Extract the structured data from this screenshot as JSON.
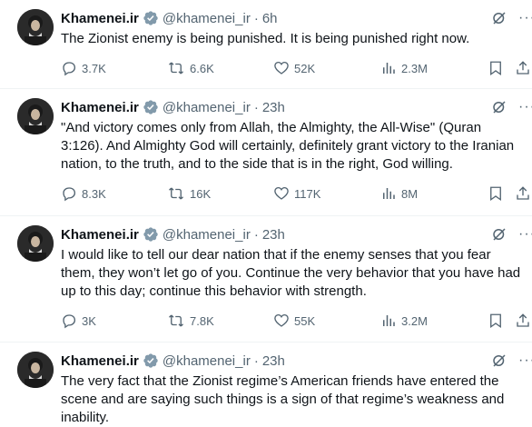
{
  "account": {
    "name": "Khamenei.ir",
    "handle": "@khamenei_ir",
    "dot": "·"
  },
  "more_label": "···",
  "tweets": [
    {
      "time": "6h",
      "text": "The Zionist enemy is being punished. It is being punished right now.",
      "replies": "3.7K",
      "reposts": "6.6K",
      "likes": "52K",
      "views": "2.3M"
    },
    {
      "time": "23h",
      "text": "\"And victory comes only from Allah, the Almighty, the All-Wise\" (Quran 3:126). And Almighty God will certainly, definitely grant victory to the Iranian nation, to the truth, and to the side that is in the right, God willing.",
      "replies": "8.3K",
      "reposts": "16K",
      "likes": "117K",
      "views": "8M"
    },
    {
      "time": "23h",
      "text": "I would like to tell our dear nation that if the enemy senses that you fear them, they won’t let go of you. Continue the very behavior that you have had up to this day; continue this behavior with strength.",
      "replies": "3K",
      "reposts": "7.8K",
      "likes": "55K",
      "views": "3.2M"
    },
    {
      "time": "23h",
      "text": "The very fact that the Zionist regime’s American friends have entered the scene and are saying such things is a sign of that regime’s weakness and inability."
    }
  ],
  "colors": {
    "verified": "#829aab",
    "muted": "#536471",
    "text": "#0f1419",
    "divider": "#eff3f4"
  },
  "icons": [
    "reply-icon",
    "repost-icon",
    "like-icon",
    "views-icon",
    "bookmark-icon",
    "share-icon",
    "grok-icon",
    "verified-icon"
  ]
}
